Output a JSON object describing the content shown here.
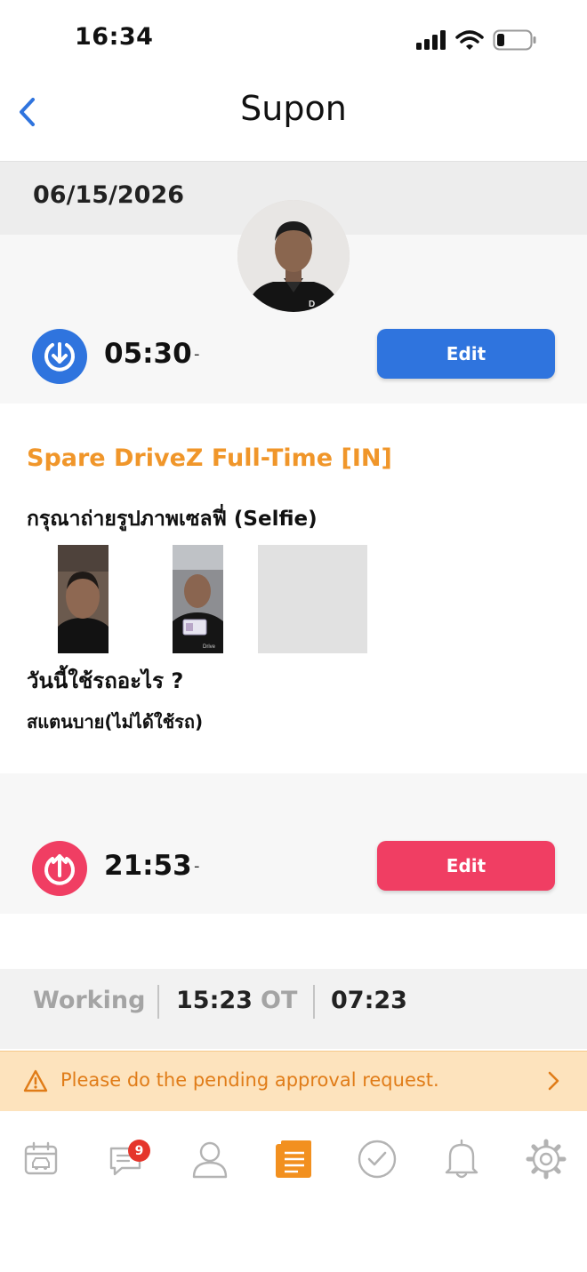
{
  "status_bar": {
    "time": "16:34"
  },
  "nav": {
    "title": "Supon"
  },
  "date": "06/15/2026",
  "check_in": {
    "time": "05:30",
    "dash": "-",
    "edit_label": "Edit"
  },
  "details": {
    "shift_title": "Spare DriveZ Full-Time [IN]",
    "selfie_label": "กรุณาถ่ายรูปภาพเซลฟี่ (Selfie)",
    "question": "วันนี้ใช้รถอะไร ?",
    "answer": "สแตนบาย(ไม่ได้ใช้รถ)"
  },
  "check_out": {
    "time": "21:53",
    "dash": "-",
    "edit_label": "Edit"
  },
  "summary": {
    "working_label": "Working",
    "working_value": "15:23",
    "ot_label": "OT",
    "ot_value": "07:23"
  },
  "banner": {
    "text": "Please do the pending approval request."
  },
  "tab_bar": {
    "items": [
      "calendar-car-icon",
      "chat-icon",
      "profile-icon",
      "timesheet-icon",
      "approve-icon",
      "bell-icon",
      "settings-icon"
    ],
    "active": "timesheet-icon",
    "chat_badge": "9"
  },
  "colors": {
    "primary_blue": "#2f74de",
    "checkout_red": "#f03e63",
    "accent_orange": "#f0962a",
    "banner_bg": "#fde3bd"
  }
}
